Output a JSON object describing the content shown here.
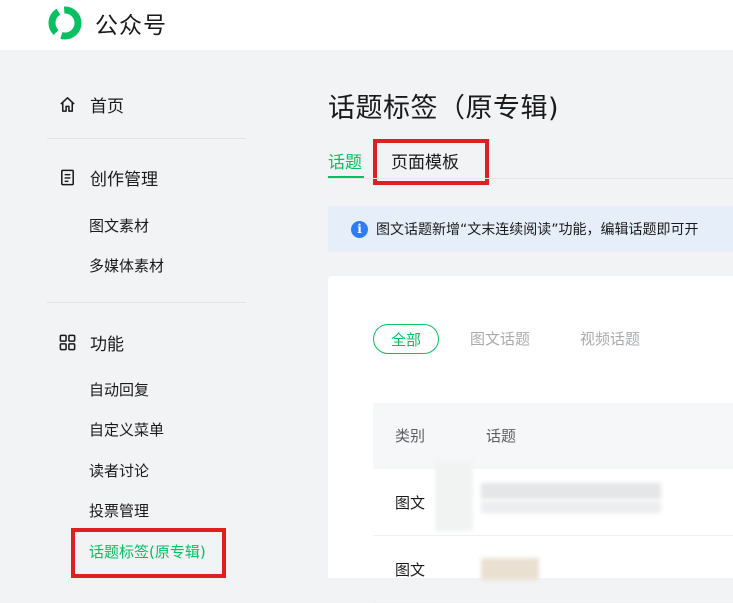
{
  "header": {
    "brand": "公众号"
  },
  "sidebar": {
    "home": "首页",
    "create": "创作管理",
    "create_items": [
      "图文素材",
      "多媒体素材"
    ],
    "features": "功能",
    "feature_items": [
      "自动回复",
      "自定义菜单",
      "读者讨论",
      "投票管理",
      "话题标签(原专辑)"
    ]
  },
  "main": {
    "title": "话题标签（原专辑)",
    "tabs": [
      "话题",
      "页面模板"
    ],
    "notice": "图文话题新增“文末连续阅读”功能，编辑话题即可开",
    "filters": [
      "全部",
      "图文话题",
      "视频话题"
    ],
    "table": {
      "headers": [
        "类别",
        "话题"
      ],
      "rows": [
        "图文",
        "图文"
      ]
    }
  },
  "colors": {
    "accent": "#07c160",
    "highlight_box": "#e02020",
    "info": "#2f7bf6"
  }
}
